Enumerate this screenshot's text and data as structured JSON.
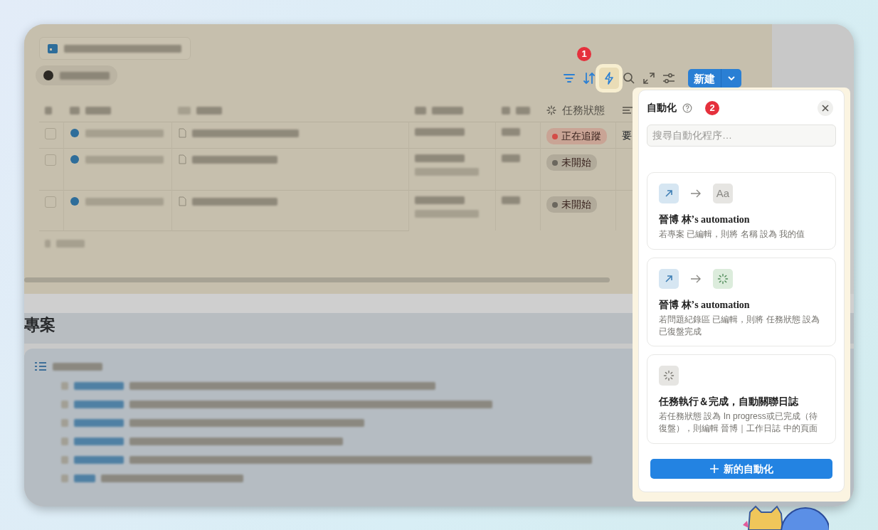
{
  "toolbar": {
    "callout": "1",
    "buttons": [
      {
        "kind": "filter",
        "selected": false
      },
      {
        "kind": "sort",
        "selected": false
      },
      {
        "kind": "automation",
        "selected": true
      },
      {
        "kind": "search",
        "selected": false
      },
      {
        "kind": "expand",
        "selected": false
      },
      {
        "kind": "settings",
        "selected": false
      }
    ],
    "new_button": {
      "label": "新建"
    }
  },
  "table": {
    "status_column": {
      "label": "任務狀態"
    },
    "rows": [
      {
        "kind": "single",
        "checked": false,
        "status": "正在追蹤",
        "color": "#d44c47",
        "extra": "要"
      },
      {
        "kind": "range",
        "checked": false,
        "status": "未開始",
        "color": "#6b675e"
      },
      {
        "kind": "range",
        "checked": false,
        "status": "未開始",
        "color": "#6b675e"
      }
    ]
  },
  "section": {
    "title": "專案"
  },
  "panel": {
    "title": "自動化",
    "callout": "2",
    "search": {
      "placeholder": "搜尋自動化程序…"
    },
    "automations": [
      {
        "icons": [
          {
            "kind": "arrow"
          },
          {
            "kind": "text",
            "label": "Aa"
          }
        ],
        "title": "晉博 林’s automation",
        "description": "若專案 已編輯，則將 名稱 設為 我的值"
      },
      {
        "icons": [
          {
            "kind": "arrow"
          },
          {
            "kind": "status"
          }
        ],
        "title": "晉博 林’s automation",
        "description": "若問題紀錄區 已編輯，則將 任務狀態 設為已復盤完成"
      },
      {
        "icons": [
          {
            "kind": "status"
          }
        ],
        "title": "任務執行＆完成，自動關聯日誌",
        "description": "若任務狀態 設為 In progress或已完成（待復盤），則編輯 晉博｜工作日誌 中的頁面"
      }
    ],
    "add_button": {
      "label": "新的自動化"
    }
  }
}
